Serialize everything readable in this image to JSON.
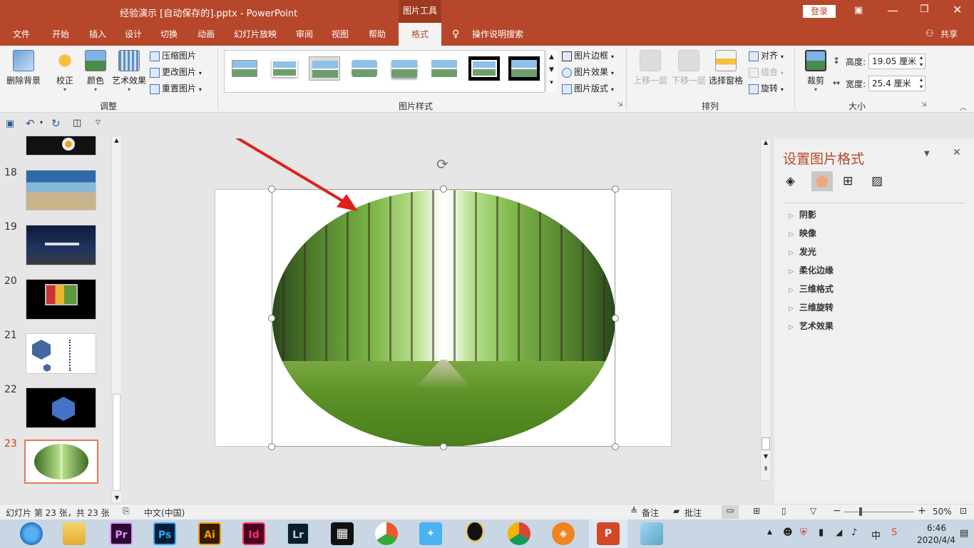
{
  "window": {
    "title": "经验演示 [自动保存的].pptx  -  PowerPoint",
    "context_tool": "图片工具",
    "login_button": "登录",
    "share_label": "共享"
  },
  "tabs": [
    "文件",
    "开始",
    "插入",
    "设计",
    "切换",
    "动画",
    "幻灯片放映",
    "审阅",
    "视图",
    "帮助",
    "格式"
  ],
  "active_tab": "格式",
  "tell_me": "操作说明搜索",
  "ribbon": {
    "adjust": {
      "remove_bg": "删除背景",
      "correct": "校正",
      "color": "颜色",
      "art_effect": "艺术效果",
      "compress": "压缩图片",
      "change": "更改图片",
      "reset": "重置图片",
      "label": "调整"
    },
    "styles": {
      "label": "图片样式",
      "border": "图片边框",
      "effect": "图片效果",
      "layout": "图片版式"
    },
    "arrange": {
      "label": "排列",
      "forward": "上移一层",
      "backward": "下移一层",
      "selection_pane": "选择窗格",
      "align": "对齐",
      "group": "组合",
      "rotate": "旋转"
    },
    "size": {
      "label": "大小",
      "crop": "裁剪",
      "height_label": "高度:",
      "height_value": "19.05 厘米",
      "width_label": "宽度:",
      "width_value": "25.4 厘米"
    }
  },
  "slides": [
    {
      "num": "18"
    },
    {
      "num": "19"
    },
    {
      "num": "20"
    },
    {
      "num": "21"
    },
    {
      "num": "22"
    },
    {
      "num": "23",
      "active": true
    }
  ],
  "format_pane": {
    "title": "设置图片格式",
    "items": [
      "阴影",
      "映像",
      "发光",
      "柔化边缘",
      "三维格式",
      "三维旋转",
      "艺术效果"
    ]
  },
  "status": {
    "slide_info": "幻灯片 第 23 张，共 23 张",
    "language": "中文(中国)",
    "notes": "备注",
    "comments": "批注",
    "zoom": "50%"
  },
  "taskbar": {
    "apps": [
      "Pr",
      "Ps",
      "Ai",
      "Id",
      "Lr"
    ],
    "ime": "中",
    "time": "6:46",
    "date": "2020/4/4"
  },
  "colors": {
    "accent": "#b7472a",
    "arrow": "#e0201a"
  }
}
